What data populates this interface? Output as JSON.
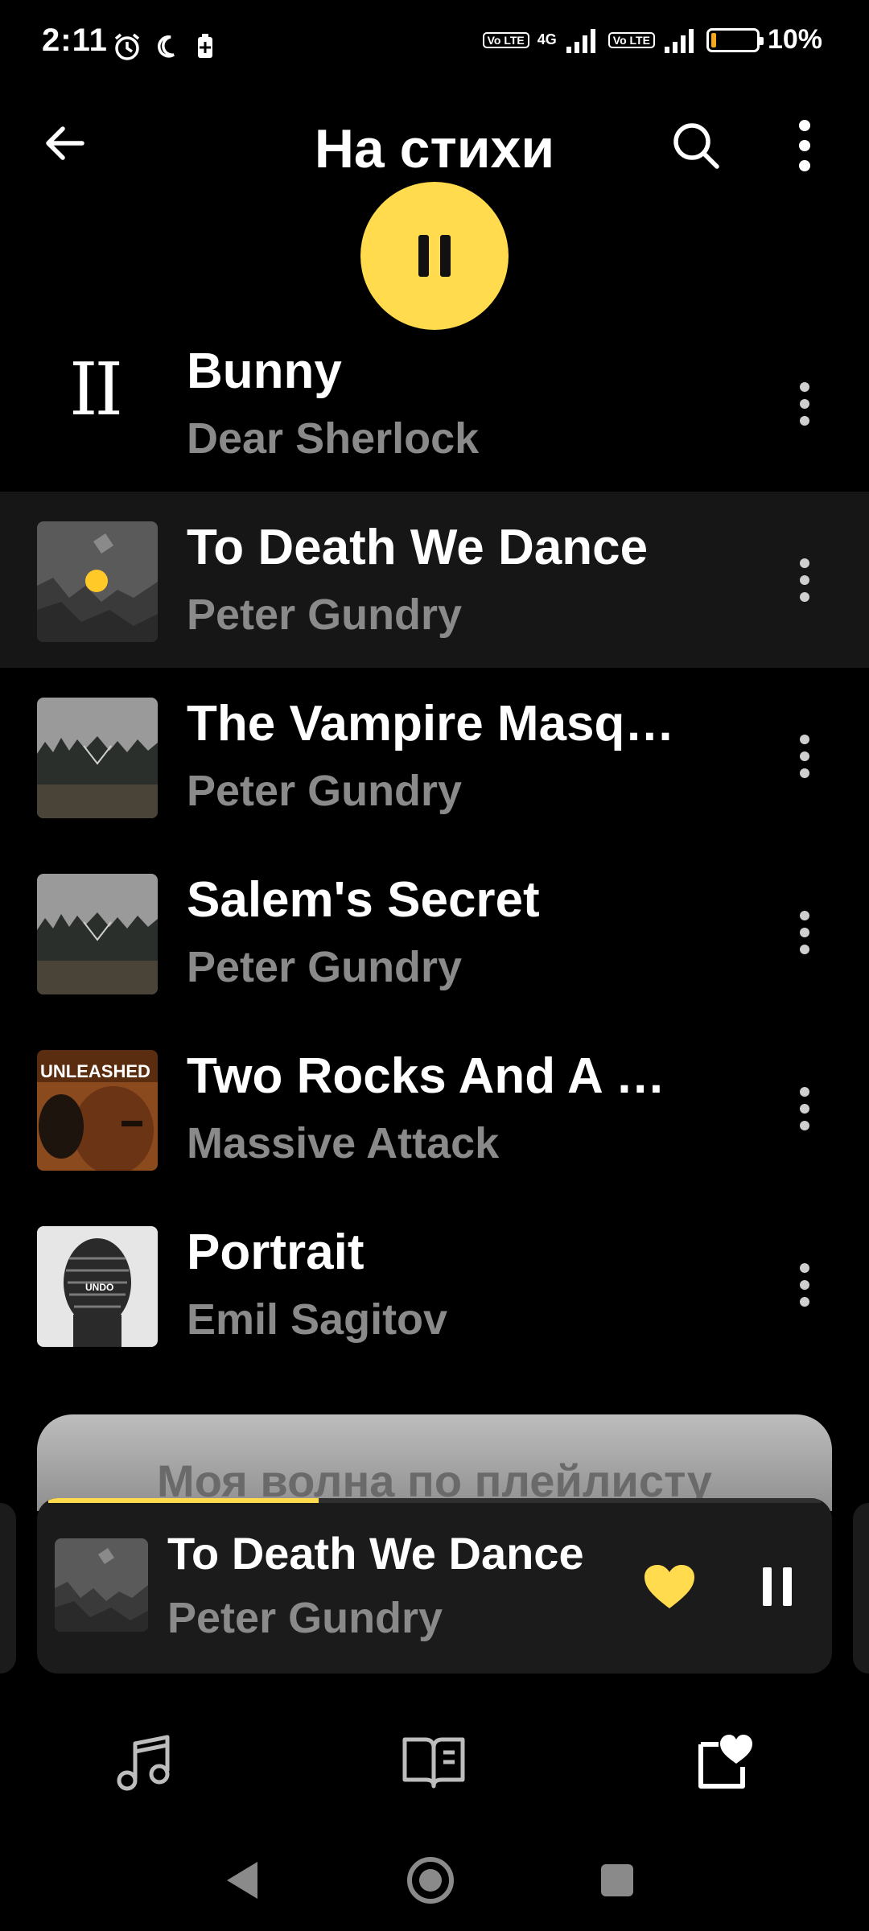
{
  "status_bar": {
    "time": "2:11",
    "network": "4G",
    "volte": "Vo LTE",
    "battery_percent": "10%",
    "battery_level": 0.1
  },
  "header": {
    "title": "На стихи"
  },
  "tracks": [
    {
      "title": "Bunny",
      "artist": "Dear Sherlock",
      "playing": true,
      "pause_glyph": "II"
    },
    {
      "title": "To Death We Dance",
      "artist": "Peter Gundry",
      "active": true
    },
    {
      "title": "The Vampire Masq…",
      "artist": "Peter Gundry"
    },
    {
      "title": "Salem's Secret",
      "artist": "Peter Gundry"
    },
    {
      "title": "Two Rocks And A …",
      "artist": "Massive Attack",
      "cover_text": "UNLEASHED"
    },
    {
      "title": "Portrait",
      "artist": "Emil Sagitov",
      "cover_text": "UNDO"
    }
  ],
  "wave_card": {
    "label": "Моя волна по плейлисту"
  },
  "mini_player": {
    "title": "To Death We Dance",
    "artist": "Peter Gundry",
    "progress": 0.35,
    "liked": true
  },
  "colors": {
    "accent": "#ffdb4d",
    "background": "#000000",
    "secondary_text": "#8a8a8a",
    "active_row": "#161616"
  },
  "icons": {
    "header": [
      "back-arrow-icon",
      "search-icon",
      "more-vertical-icon"
    ],
    "play_fab": "pause-icon",
    "mini": [
      "heart-icon",
      "pause-icon"
    ],
    "bottom_nav": [
      "music-note-icon",
      "book-podcast-icon",
      "collection-heart-icon"
    ],
    "system_nav": [
      "back-triangle-icon",
      "home-circle-icon",
      "recents-square-icon"
    ]
  }
}
